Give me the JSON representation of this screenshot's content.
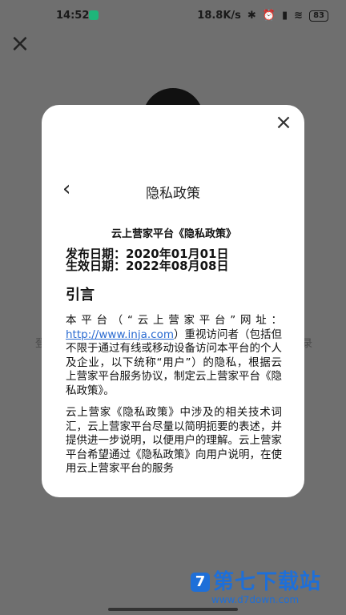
{
  "status_bar": {
    "time": "14:52",
    "speed": "18.8K/s",
    "battery": "83",
    "icons": [
      "shield-icon",
      "bluetooth-off-icon",
      "alarm-icon",
      "signal-icon",
      "wifi-icon",
      "battery-icon"
    ]
  },
  "background": {
    "left_text": "登",
    "right_text": "录"
  },
  "modal": {
    "page_title": "隐私政策",
    "doc_title": "云上营家平台《隐私政策》",
    "publish_date": "发布日期：2020年01月01日",
    "effective_date": "生效日期：2022年08月08日",
    "section_title": "引言",
    "para1_a": "本平台（“云上营家平台”网址：",
    "para1_link": "http://www.inja.com",
    "para1_b": "）重视访问者（包括但不限于通过有线或移动设备访问本平台的个人及企业，以下统称“用户”）的隐私，根据云上营家平台服务协议，制定云上营家平台《隐私政策》。",
    "para2": "云上营家《隐私政策》中涉及的相关技术词汇，云上营家平台尽量以简明扼要的表述，并提供进一步说明，以便用户的理解。云上营家平台希望通过《隐私政策》向用户说明，在使用云上营家平台的服务"
  },
  "watermark": {
    "logo": "7",
    "text": "第七下载站",
    "url": "www.d7down.com"
  }
}
